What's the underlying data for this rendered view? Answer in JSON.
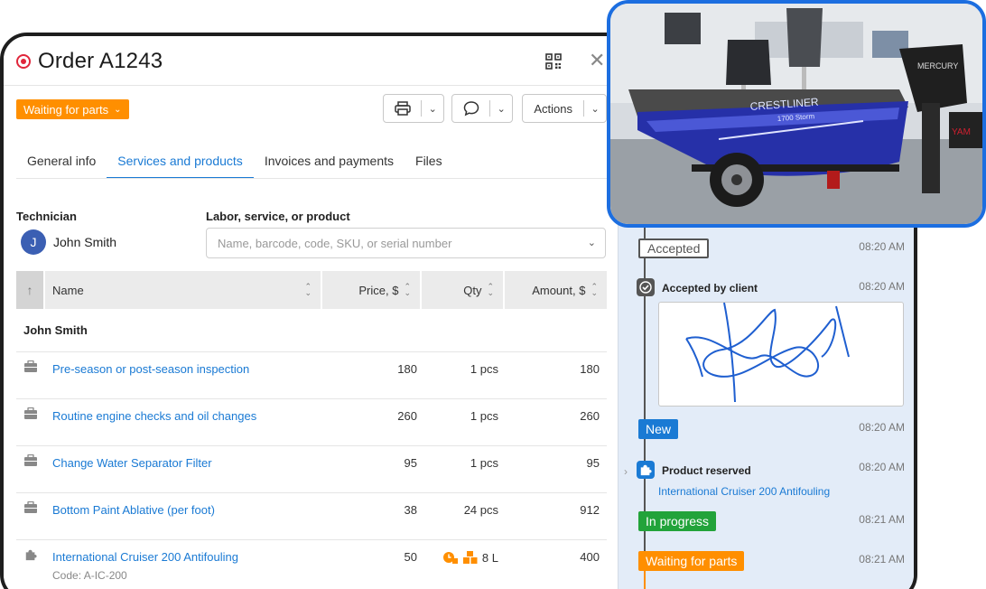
{
  "order": {
    "title": "Order A1243",
    "status": "Waiting for parts",
    "actions_label": "Actions"
  },
  "tabs": [
    "General info",
    "Services and products",
    "Invoices and payments",
    "Files"
  ],
  "technician": {
    "label": "Technician",
    "initial": "J",
    "name": "John Smith"
  },
  "search": {
    "label": "Labor, service, or product",
    "placeholder": "Name, barcode, code, SKU, or serial number"
  },
  "table": {
    "headers": {
      "name": "Name",
      "price": "Price, $",
      "qty": "Qty",
      "amount": "Amount, $"
    },
    "group": "John Smith",
    "rows": [
      {
        "icon": "briefcase-icon",
        "name": "Pre-season or post-season inspection",
        "price": "180",
        "qty": "1 pcs",
        "amount": "180"
      },
      {
        "icon": "briefcase-icon",
        "name": "Routine engine checks and oil changes",
        "price": "260",
        "qty": "1 pcs",
        "amount": "260"
      },
      {
        "icon": "briefcase-icon",
        "name": "Change Water Separator Filter",
        "price": "95",
        "qty": "1 pcs",
        "amount": "95"
      },
      {
        "icon": "briefcase-icon",
        "name": "Bottom Paint Ablative (per foot)",
        "price": "38",
        "qty": "24 pcs",
        "amount": "912"
      },
      {
        "icon": "puzzle-icon",
        "name": "International Cruiser 200 Antifouling",
        "price": "50",
        "qty": "8 L",
        "amount": "400",
        "code": "Code: A-IC-200"
      }
    ]
  },
  "timeline": [
    {
      "type": "chip",
      "kind": "accepted",
      "label": "Accepted",
      "time": "08:20 AM"
    },
    {
      "type": "event",
      "icon": "check-icon",
      "title": "Accepted by client",
      "time": "08:20 AM"
    },
    {
      "type": "chip",
      "kind": "new",
      "label": "New",
      "time": "08:20 AM"
    },
    {
      "type": "event",
      "icon": "puzzle-icon",
      "title": "Product reserved",
      "link": "International Cruiser 200 Antifouling",
      "time": "08:20 AM"
    },
    {
      "type": "chip",
      "kind": "progress",
      "label": "In progress",
      "time": "08:21 AM"
    },
    {
      "type": "chip",
      "kind": "waiting",
      "label": "Waiting for parts",
      "time": "08:21 AM"
    }
  ],
  "photo": {
    "boat_brand": "CRESTLINER",
    "boat_model": "1700 Storm",
    "motor_brand": "MERCURY",
    "motor_brand_2": "YAM"
  },
  "colors": {
    "accent": "#1a7ad4",
    "status_orange": "#ff8f00",
    "status_green": "#22a33a",
    "photo_border": "#1c6ee0"
  }
}
